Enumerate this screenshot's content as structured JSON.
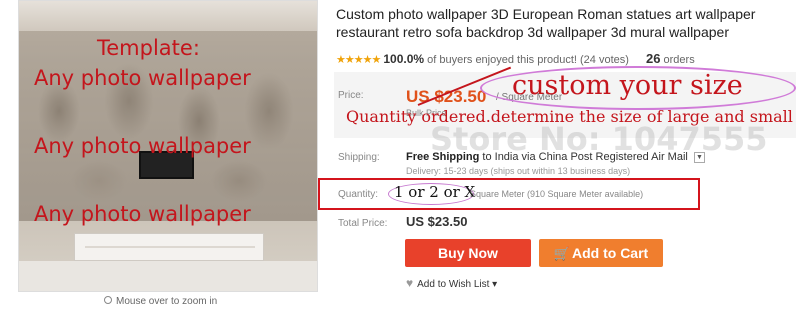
{
  "image_panel": {
    "overlay_lines": [
      "Template:",
      "Any photo wallpaper",
      "Any photo wallpaper",
      "Any photo wallpaper"
    ],
    "zoom_hint": "Mouse over to zoom in"
  },
  "product": {
    "title": "Custom photo wallpaper 3D European Roman statues art wallpaper restaurant retro sofa backdrop 3d wallpaper 3d mural wallpaper",
    "rating": {
      "stars": "★★★★★",
      "percent": "100.0%",
      "buyers_text": "of buyers enjoyed this product! (24 votes)",
      "orders_count": "26",
      "orders_label": "orders"
    }
  },
  "price": {
    "label": "Price:",
    "value": "US $23.50",
    "unit": "/ Square Meter",
    "bulk": "Bulk Price"
  },
  "annotations": {
    "custom_size": "custom your size",
    "quantity_note": "Quantity ordered.determine the size of large and small",
    "watermark": "Store No: 1047555"
  },
  "shipping": {
    "label": "Shipping:",
    "free": "Free Shipping",
    "rest": "to India via China Post Registered Air Mail",
    "delivery": "Delivery: 15-23 days (ships out within 13 business days)"
  },
  "quantity": {
    "label": "Quantity:",
    "value": "1 or 2 or X",
    "unit": "Square Meter (910 Square Meter available)"
  },
  "total": {
    "label": "Total Price:",
    "value": "US $23.50"
  },
  "buttons": {
    "buy_now": "Buy Now",
    "add_to_cart": "Add to Cart"
  },
  "wishlist": {
    "label": "Add to Wish List"
  },
  "colors": {
    "buy_button": "#e8412b",
    "cart_button": "#f07e2e",
    "price": "#e0511a",
    "annotation_red": "#c4151c"
  }
}
